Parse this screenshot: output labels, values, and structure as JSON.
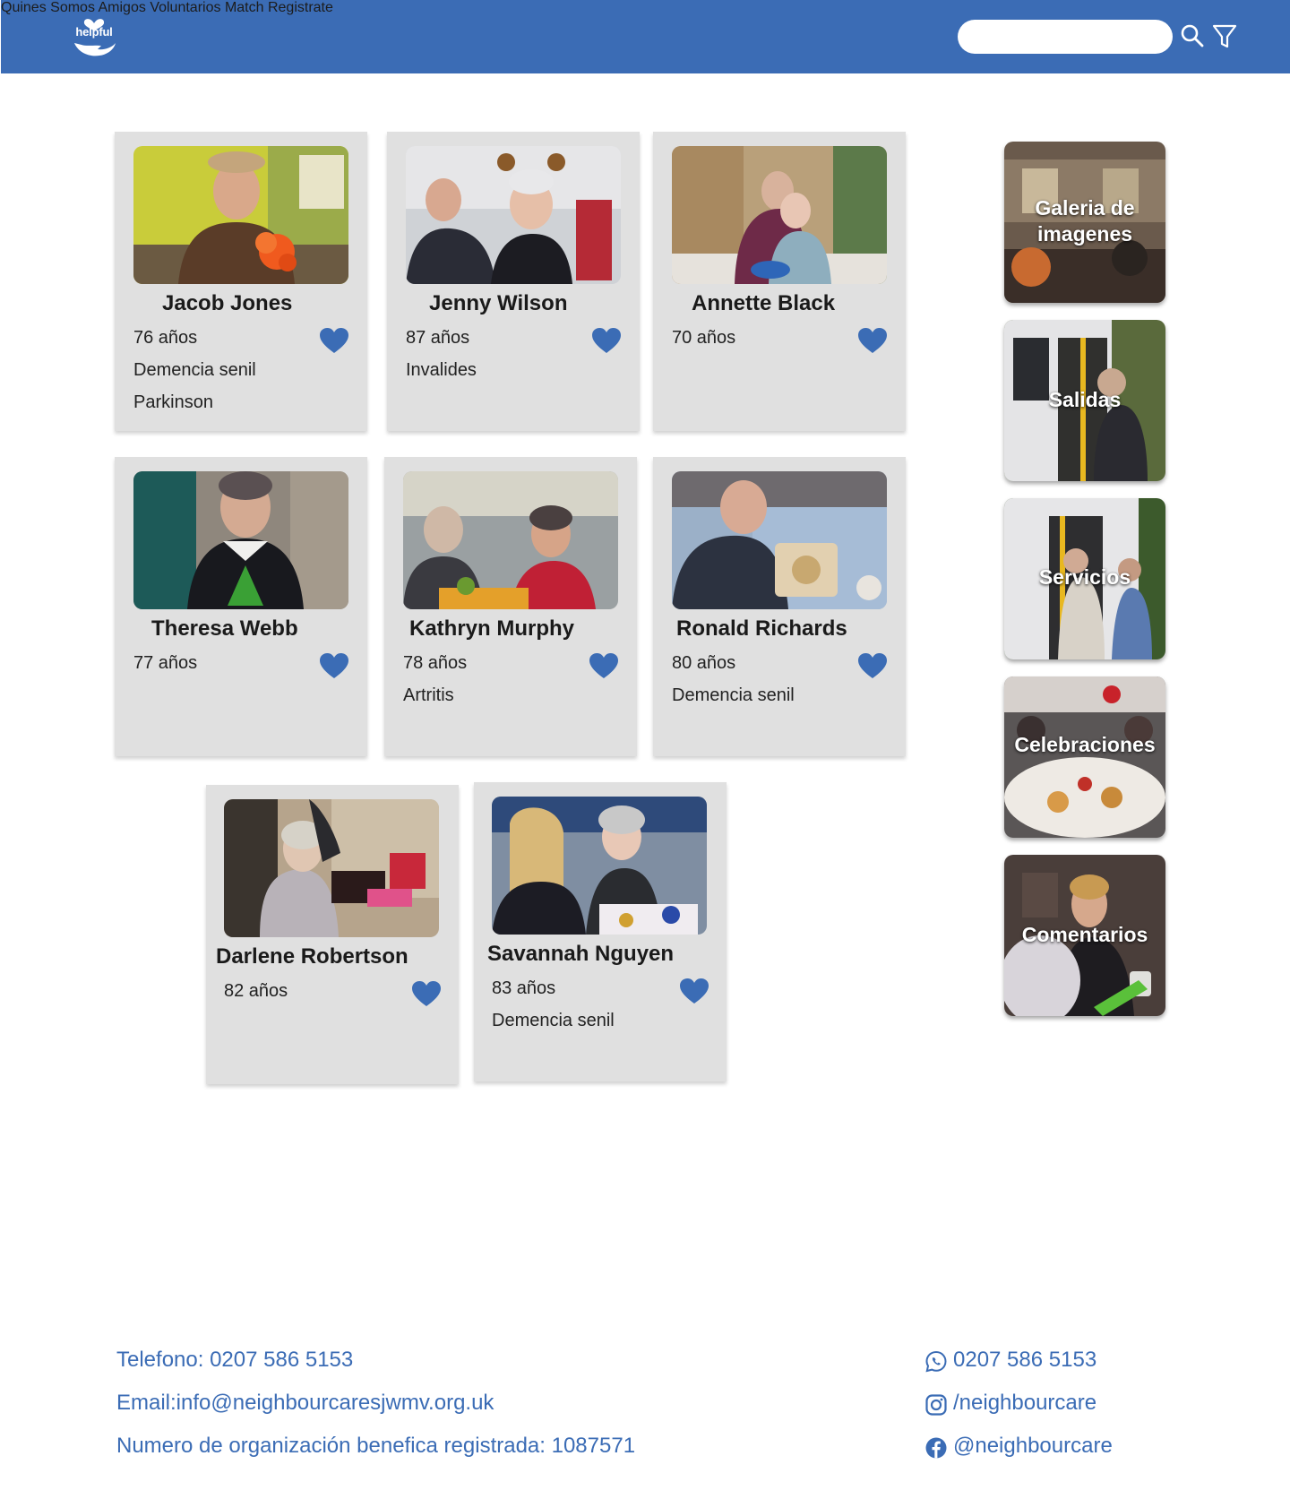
{
  "header": {
    "logo_text": "helpful",
    "nav": [
      "Quines Somos",
      "Amigos",
      "Voluntarios",
      "Match",
      "Registrate"
    ],
    "search_placeholder": "",
    "accent_color": "#3b6cb5"
  },
  "profiles": [
    {
      "name": "Jacob Jones",
      "age": "76 años",
      "conditions": [
        "Demencia senil",
        "Parkinson"
      ]
    },
    {
      "name": "Jenny Wilson",
      "age": "87 años",
      "conditions": [
        "Invalides"
      ]
    },
    {
      "name": "Annette Black",
      "age": "70 años",
      "conditions": []
    },
    {
      "name": "Theresa Webb",
      "age": "77 años",
      "conditions": []
    },
    {
      "name": "Kathryn Murphy",
      "age": "78 años",
      "conditions": [
        "Artritis"
      ]
    },
    {
      "name": "Ronald Richards",
      "age": "80 años",
      "conditions": [
        "Demencia senil"
      ]
    },
    {
      "name": "Darlene Robertson",
      "age": "82 años",
      "conditions": []
    },
    {
      "name": "Savannah Nguyen",
      "age": "83 años",
      "conditions": [
        "Demencia senil"
      ]
    }
  ],
  "categories": [
    {
      "line1": "Galeria de",
      "line2": "imagenes"
    },
    {
      "line1": "Salidas",
      "line2": ""
    },
    {
      "line1": "Servicios",
      "line2": ""
    },
    {
      "line1": "Celebraciones",
      "line2": ""
    },
    {
      "line1": "Comentarios",
      "line2": ""
    }
  ],
  "footer": {
    "phone": "Telefono: 0207 586 5153",
    "email": "Email:info@neighbourcaresjwmv.org.uk",
    "charity": "Numero de organización benefica registrada: 1087571",
    "whatsapp": "0207 586 5153",
    "instagram": "/neighbourcare",
    "facebook": "@neighbourcare"
  },
  "icons": {
    "search": "search-icon",
    "filter": "filter-icon",
    "heart": "heart-icon",
    "whatsapp": "whatsapp-icon",
    "instagram": "instagram-icon",
    "facebook": "facebook-icon"
  }
}
